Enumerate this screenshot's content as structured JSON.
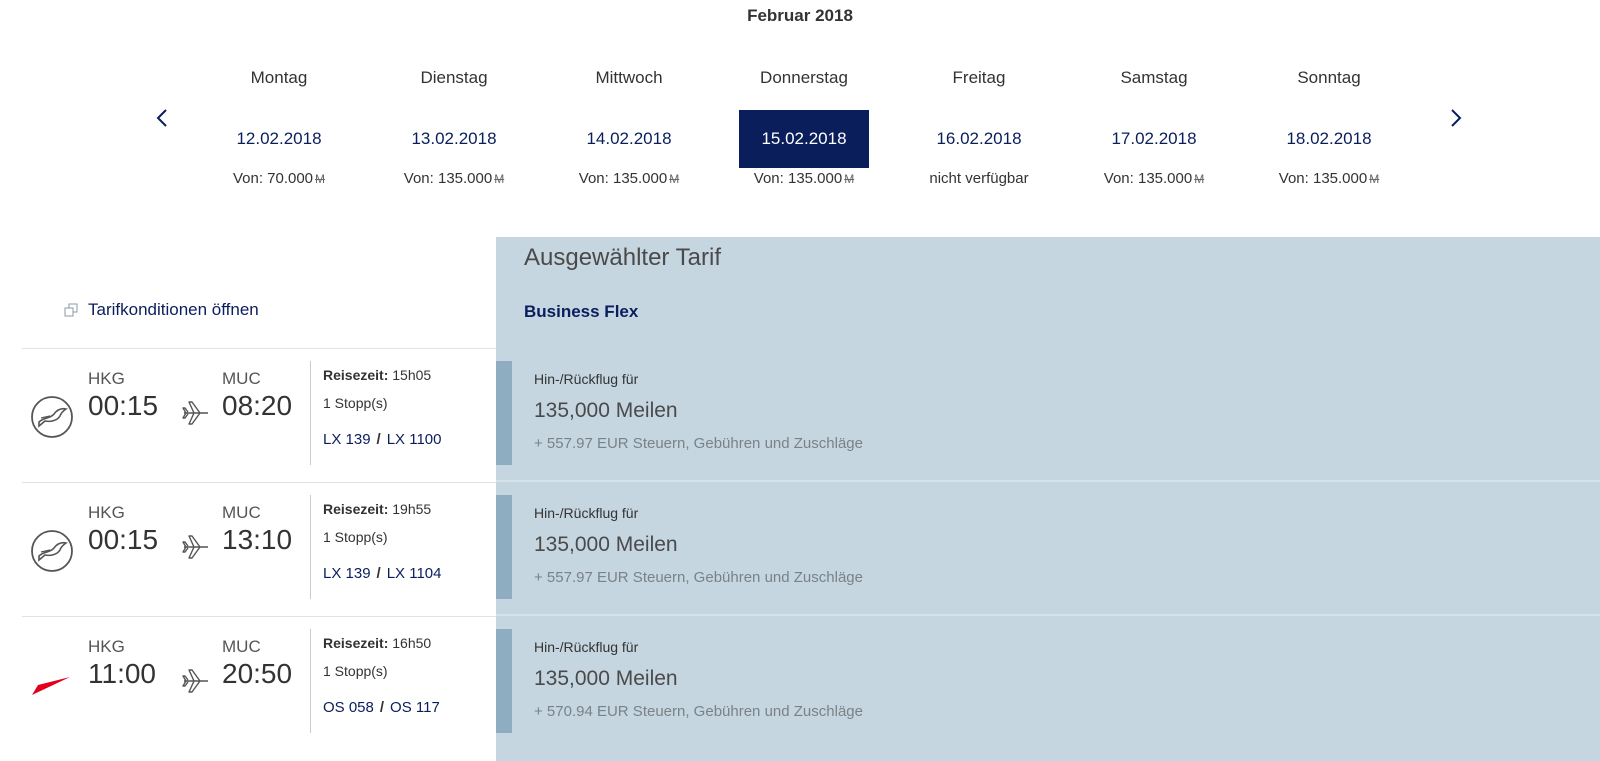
{
  "calendar": {
    "month": "Februar 2018",
    "days": [
      {
        "name": "Montag",
        "date": "12.02.2018",
        "price": "Von: 70.000",
        "miles_symbol": "M",
        "selected": false
      },
      {
        "name": "Dienstag",
        "date": "13.02.2018",
        "price": "Von: 135.000",
        "miles_symbol": "M",
        "selected": false
      },
      {
        "name": "Mittwoch",
        "date": "14.02.2018",
        "price": "Von: 135.000",
        "miles_symbol": "M",
        "selected": false
      },
      {
        "name": "Donnerstag",
        "date": "15.02.2018",
        "price": "Von: 135.000",
        "miles_symbol": "M",
        "selected": true
      },
      {
        "name": "Freitag",
        "date": "16.02.2018",
        "price": "nicht verfügbar",
        "miles_symbol": "",
        "selected": false
      },
      {
        "name": "Samstag",
        "date": "17.02.2018",
        "price": "Von: 135.000",
        "miles_symbol": "M",
        "selected": false
      },
      {
        "name": "Sonntag",
        "date": "18.02.2018",
        "price": "Von: 135.000",
        "miles_symbol": "M",
        "selected": false
      }
    ]
  },
  "fare": {
    "heading": "Ausgewählter Tarif",
    "name": "Business Flex",
    "conditions_link": "Tarifkonditionen öffnen"
  },
  "flights": [
    {
      "airline_icon": "lufthansa-crane-icon",
      "origin": "HKG",
      "departure": "00:15",
      "destination": "MUC",
      "arrival": "08:20",
      "duration_label": "Reisezeit:",
      "duration": "15h05",
      "stops": "1 Stopp(s)",
      "flight_numbers": [
        "LX 139",
        "LX 1100"
      ],
      "fare_label": "Hin-/Rückflug für",
      "miles": "135,000 Meilen",
      "taxes": "+ 557.97 EUR Steuern, Gebühren und Zuschläge"
    },
    {
      "airline_icon": "lufthansa-crane-icon",
      "origin": "HKG",
      "departure": "00:15",
      "destination": "MUC",
      "arrival": "13:10",
      "duration_label": "Reisezeit:",
      "duration": "19h55",
      "stops": "1 Stopp(s)",
      "flight_numbers": [
        "LX 139",
        "LX 1104"
      ],
      "fare_label": "Hin-/Rückflug für",
      "miles": "135,000 Meilen",
      "taxes": "+ 557.97 EUR Steuern, Gebühren und Zuschläge"
    },
    {
      "airline_icon": "austrian-chevron-icon",
      "origin": "HKG",
      "departure": "11:00",
      "destination": "MUC",
      "arrival": "20:50",
      "duration_label": "Reisezeit:",
      "duration": "16h50",
      "stops": "1 Stopp(s)",
      "flight_numbers": [
        "OS 058",
        "OS 117"
      ],
      "fare_label": "Hin-/Rückflug für",
      "miles": "135,000 Meilen",
      "taxes": "+ 570.94 EUR Steuern, Gebühren und Zuschläge"
    }
  ],
  "colors": {
    "brand_navy": "#0a1e5c",
    "fare_panel": "#c5d6e0",
    "fare_accent": "#8fadc1",
    "austrian_red": "#e3001b"
  }
}
